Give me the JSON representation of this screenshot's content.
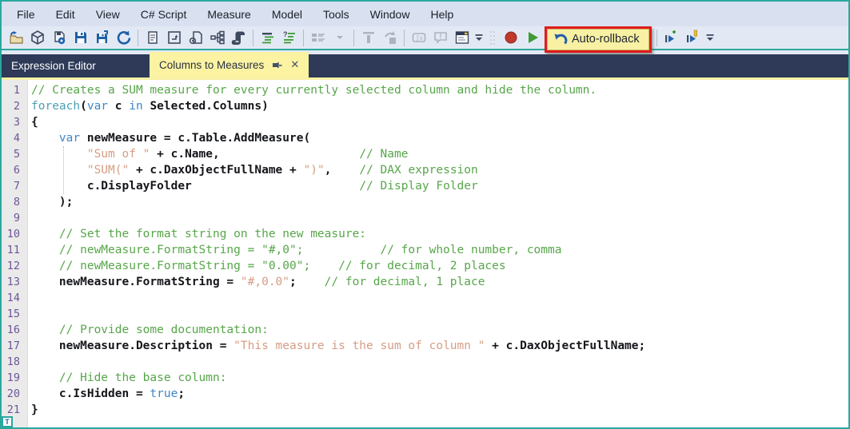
{
  "menu": {
    "items": [
      "File",
      "Edit",
      "View",
      "C# Script",
      "Measure",
      "Model",
      "Tools",
      "Window",
      "Help"
    ]
  },
  "toolbar": {
    "auto_rollback_label": "Auto-rollback",
    "icons": [
      "open-file-icon",
      "model-cube-icon",
      "deploy-save-icon",
      "save-icon",
      "save-as-icon",
      "refresh-icon",
      "new-document-icon",
      "window-arrow-icon",
      "page-gear-icon",
      "hierarchy-icon",
      "script-icon",
      "format-code-icon",
      "format-code-alt-icon",
      "comment-blocks-icon",
      "dropdown-arrow-icon",
      "align-top-icon",
      "move-into-icon",
      "code-literal-icon",
      "message-bubble-icon",
      "window-preview-icon",
      "toolbar-overflow-icon",
      "grip-dots",
      "record-icon",
      "run-script-icon",
      "undo-icon",
      "run-add-icon",
      "run-edit-icon",
      "toolbar-overflow-icon"
    ]
  },
  "tabs": {
    "panel_label": "Expression Editor",
    "active_tab_label": "Columns to Measures",
    "tab_icons": [
      "pin-icon",
      "close-icon"
    ]
  },
  "colors": {
    "window_border": "#2ba89e",
    "menubar_bg": "#d9e1f1",
    "toolbar_bg": "#e3e9f4",
    "tabstrip_bg": "#2e3a57",
    "active_tab_bg": "#fbf3a2",
    "highlight_box": "#e01b1b",
    "comment": "#57a64a",
    "string": "#d69d85",
    "keyword": "#3e86c8",
    "line_number": "#6f5596"
  },
  "editor": {
    "badge": "T",
    "lines": [
      {
        "n": "1",
        "segs": [
          [
            "c",
            "// Creates a SUM measure for every currently selected column and hide the column."
          ]
        ]
      },
      {
        "n": "2",
        "segs": [
          [
            "kc",
            "foreach"
          ],
          [
            "d",
            "("
          ],
          [
            "k",
            "var"
          ],
          [
            "d",
            " c "
          ],
          [
            "k",
            "in"
          ],
          [
            "d",
            " Selected.Columns)"
          ]
        ]
      },
      {
        "n": "3",
        "segs": [
          [
            "d",
            "{"
          ]
        ]
      },
      {
        "n": "4",
        "segs": [
          [
            "d",
            "    "
          ],
          [
            "k",
            "var"
          ],
          [
            "d",
            " newMeasure = c.Table.AddMeasure("
          ]
        ]
      },
      {
        "n": "5",
        "segs": [
          [
            "d",
            "        "
          ],
          [
            "s",
            "\"Sum of \""
          ],
          [
            "d",
            " + c.Name,                    "
          ],
          [
            "c",
            "// Name"
          ]
        ]
      },
      {
        "n": "6",
        "segs": [
          [
            "d",
            "        "
          ],
          [
            "s",
            "\"SUM(\""
          ],
          [
            "d",
            " + c.DaxObjectFullName + "
          ],
          [
            "s",
            "\")\""
          ],
          [
            "d",
            ",    "
          ],
          [
            "c",
            "// DAX expression"
          ]
        ]
      },
      {
        "n": "7",
        "segs": [
          [
            "d",
            "        c.DisplayFolder                        "
          ],
          [
            "c",
            "// Display Folder"
          ]
        ]
      },
      {
        "n": "8",
        "segs": [
          [
            "d",
            "    );"
          ]
        ]
      },
      {
        "n": "9",
        "segs": []
      },
      {
        "n": "10",
        "segs": [
          [
            "d",
            "    "
          ],
          [
            "c",
            "// Set the format string on the new measure:"
          ]
        ]
      },
      {
        "n": "11",
        "segs": [
          [
            "d",
            "    "
          ],
          [
            "c",
            "// newMeasure.FormatString = \"#,0\";           // for whole number, comma"
          ]
        ]
      },
      {
        "n": "12",
        "segs": [
          [
            "d",
            "    "
          ],
          [
            "c",
            "// newMeasure.FormatString = \"0.00\";    // for decimal, 2 places"
          ]
        ]
      },
      {
        "n": "13",
        "segs": [
          [
            "d",
            "    newMeasure.FormatString = "
          ],
          [
            "s",
            "\"#,0.0\""
          ],
          [
            "d",
            ";    "
          ],
          [
            "c",
            "// for decimal, 1 place"
          ]
        ]
      },
      {
        "n": "14",
        "segs": []
      },
      {
        "n": "15",
        "segs": []
      },
      {
        "n": "16",
        "segs": [
          [
            "d",
            "    "
          ],
          [
            "c",
            "// Provide some documentation:"
          ]
        ]
      },
      {
        "n": "17",
        "segs": [
          [
            "d",
            "    newMeasure.Description = "
          ],
          [
            "s",
            "\"This measure is the sum of column \""
          ],
          [
            "d",
            " + c.DaxObjectFullName;"
          ]
        ]
      },
      {
        "n": "18",
        "segs": []
      },
      {
        "n": "19",
        "segs": [
          [
            "d",
            "    "
          ],
          [
            "c",
            "// Hide the base column:"
          ]
        ]
      },
      {
        "n": "20",
        "segs": [
          [
            "d",
            "    c.IsHidden = "
          ],
          [
            "k",
            "true"
          ],
          [
            "d",
            ";"
          ]
        ]
      },
      {
        "n": "21",
        "segs": [
          [
            "d",
            "}"
          ]
        ]
      }
    ]
  }
}
